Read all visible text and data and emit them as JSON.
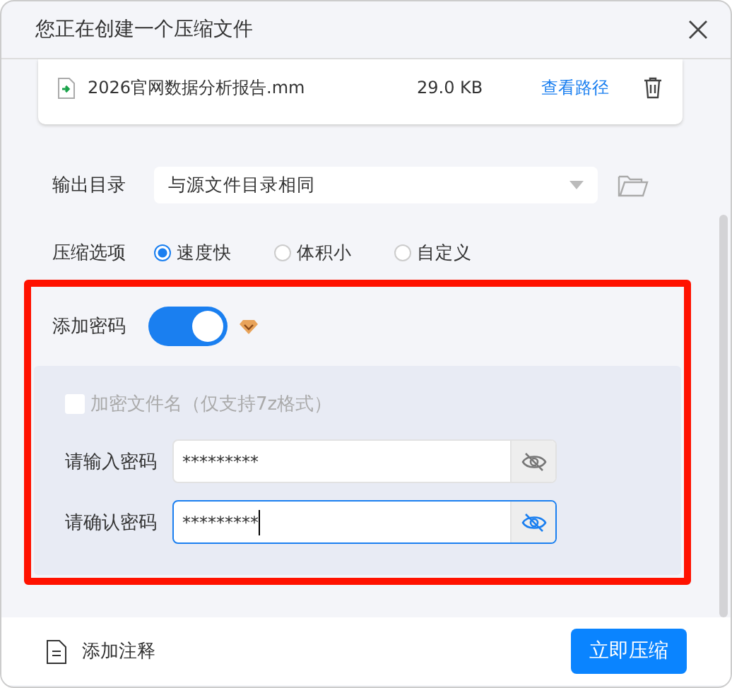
{
  "window": {
    "title": "您正在创建一个压缩文件"
  },
  "files": [
    {
      "name": "2026官网数据分析报告.mm",
      "size": "29.0 KB",
      "link": "查看路径"
    }
  ],
  "output": {
    "label": "输出目录",
    "value": "与源文件目录相同"
  },
  "compression": {
    "label": "压缩选项",
    "options": [
      {
        "label": "速度快",
        "selected": true
      },
      {
        "label": "体积小",
        "selected": false
      },
      {
        "label": "自定义",
        "selected": false
      }
    ]
  },
  "password": {
    "label": "添加密码",
    "on": true,
    "encrypt_names": {
      "label": "加密文件名（仅支持7z格式）",
      "checked": false,
      "disabled": true
    },
    "fields": [
      {
        "label": "请输入密码",
        "value": "*********",
        "focused": false
      },
      {
        "label": "请确认密码",
        "value": "*********",
        "focused": true
      }
    ]
  },
  "footer": {
    "comment": "添加注释",
    "submit": "立即压缩"
  }
}
